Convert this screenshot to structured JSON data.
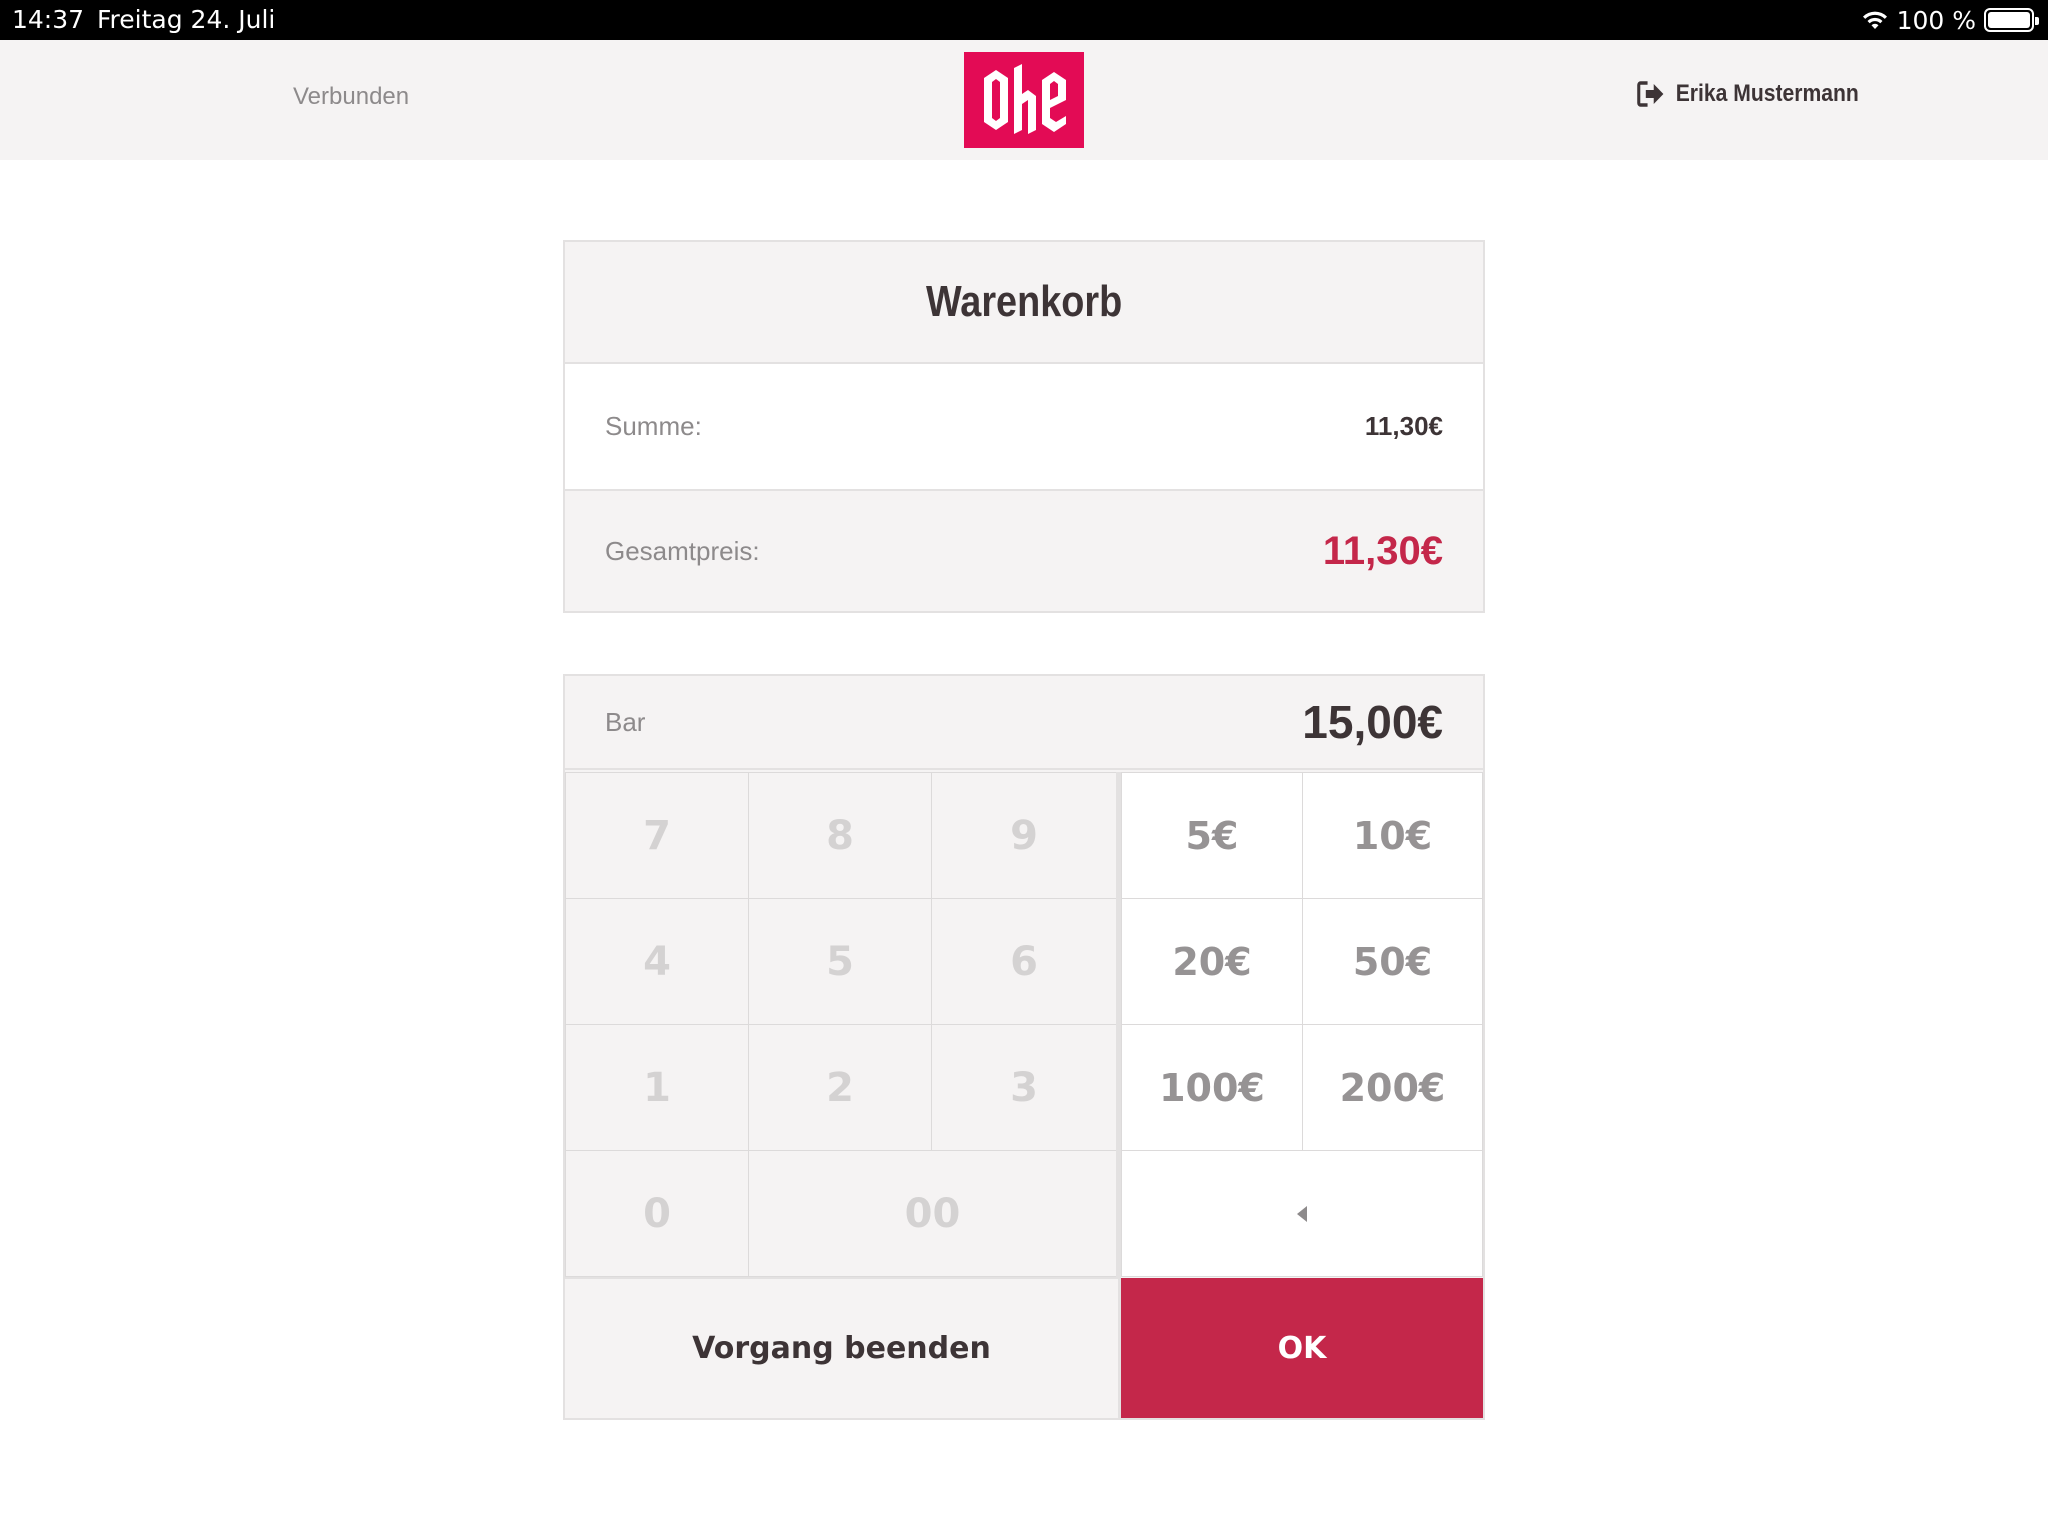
{
  "status_bar": {
    "time": "14:37",
    "date": "Freitag 24. Juli",
    "battery": "100 %"
  },
  "header": {
    "connection_status": "Verbunden",
    "logo_text": "Ohe",
    "user_name": "Erika Mustermann",
    "brand_color": "#e30b55"
  },
  "cart": {
    "title": "Warenkorb",
    "sum_label": "Summe:",
    "sum_value": "11,30€",
    "total_label": "Gesamtpreis:",
    "total_value": "11,30€",
    "accent_color": "#c4274a"
  },
  "payment": {
    "method_label": "Bar",
    "amount": "15,00€",
    "number_keys": [
      "7",
      "8",
      "9",
      "4",
      "5",
      "6",
      "1",
      "2",
      "3",
      "0",
      "00"
    ],
    "money_keys": [
      "5€",
      "10€",
      "20€",
      "50€",
      "100€",
      "200€"
    ],
    "end_label": "Vorgang beenden",
    "ok_label": "OK"
  }
}
